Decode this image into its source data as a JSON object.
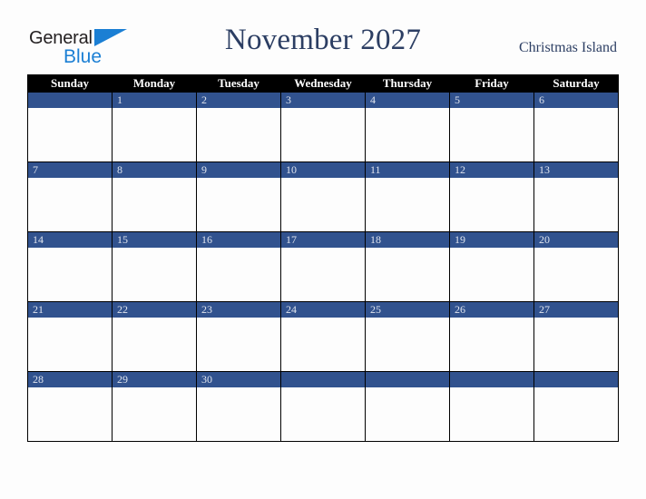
{
  "brand": {
    "name_part1": "General",
    "name_part2": "Blue",
    "triangle_icon": "triangle-icon",
    "accent_blue": "#1b7fd4",
    "text_dark": "#231f20"
  },
  "header": {
    "title": "November 2027",
    "location": "Christmas Island",
    "title_color": "#2c3e63"
  },
  "calendar": {
    "weekday_headers": [
      "Sunday",
      "Monday",
      "Tuesday",
      "Wednesday",
      "Thursday",
      "Friday",
      "Saturday"
    ],
    "header_background": "#000000",
    "header_text_color": "#ffffff",
    "day_bar_color": "#31528e",
    "day_number_color": "#dfe4ee",
    "cell_background": "#fdfdfd",
    "grid_line_color": "#000000",
    "weeks": [
      [
        "",
        "1",
        "2",
        "3",
        "4",
        "5",
        "6"
      ],
      [
        "7",
        "8",
        "9",
        "10",
        "11",
        "12",
        "13"
      ],
      [
        "14",
        "15",
        "16",
        "17",
        "18",
        "19",
        "20"
      ],
      [
        "21",
        "22",
        "23",
        "24",
        "25",
        "26",
        "27"
      ],
      [
        "28",
        "29",
        "30",
        "",
        "",
        "",
        ""
      ]
    ]
  }
}
